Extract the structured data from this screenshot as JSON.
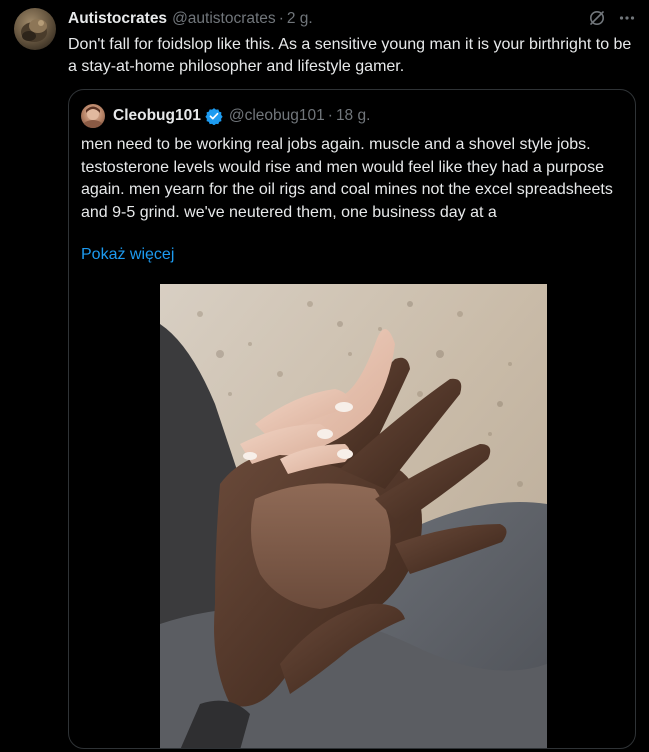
{
  "tweet": {
    "author": {
      "display_name": "Autistocrates",
      "handle": "@autistocrates",
      "separator": "·",
      "time": "2 g."
    },
    "text": "Don't fall for foidslop like this. As a sensitive young man it is your birthright to be a stay-at-home philosopher and lifestyle gamer.",
    "icons": [
      "grok-icon",
      "more-icon"
    ]
  },
  "quote": {
    "author": {
      "display_name": "Cleobug101",
      "handle": "@cleobug101",
      "separator": "·",
      "time": "18 g.",
      "verified": true
    },
    "text": "men need to be working real jobs again. muscle and a shovel style jobs. testosterone levels would rise and men would feel like they had a purpose again. men yearn for the oil rigs and coal mines not the excel spreadsheets and 9-5 grind. we've neutered them, one business day at a",
    "show_more_label": "Pokaż więcej",
    "media": {
      "kind": "photo",
      "description_icon": "hands-photo"
    }
  },
  "colors": {
    "background": "#000000",
    "text_primary": "#e7e9ea",
    "text_secondary": "#71767b",
    "link": "#1d9bf0",
    "border": "#2f3336",
    "verified": "#1d9bf0"
  }
}
